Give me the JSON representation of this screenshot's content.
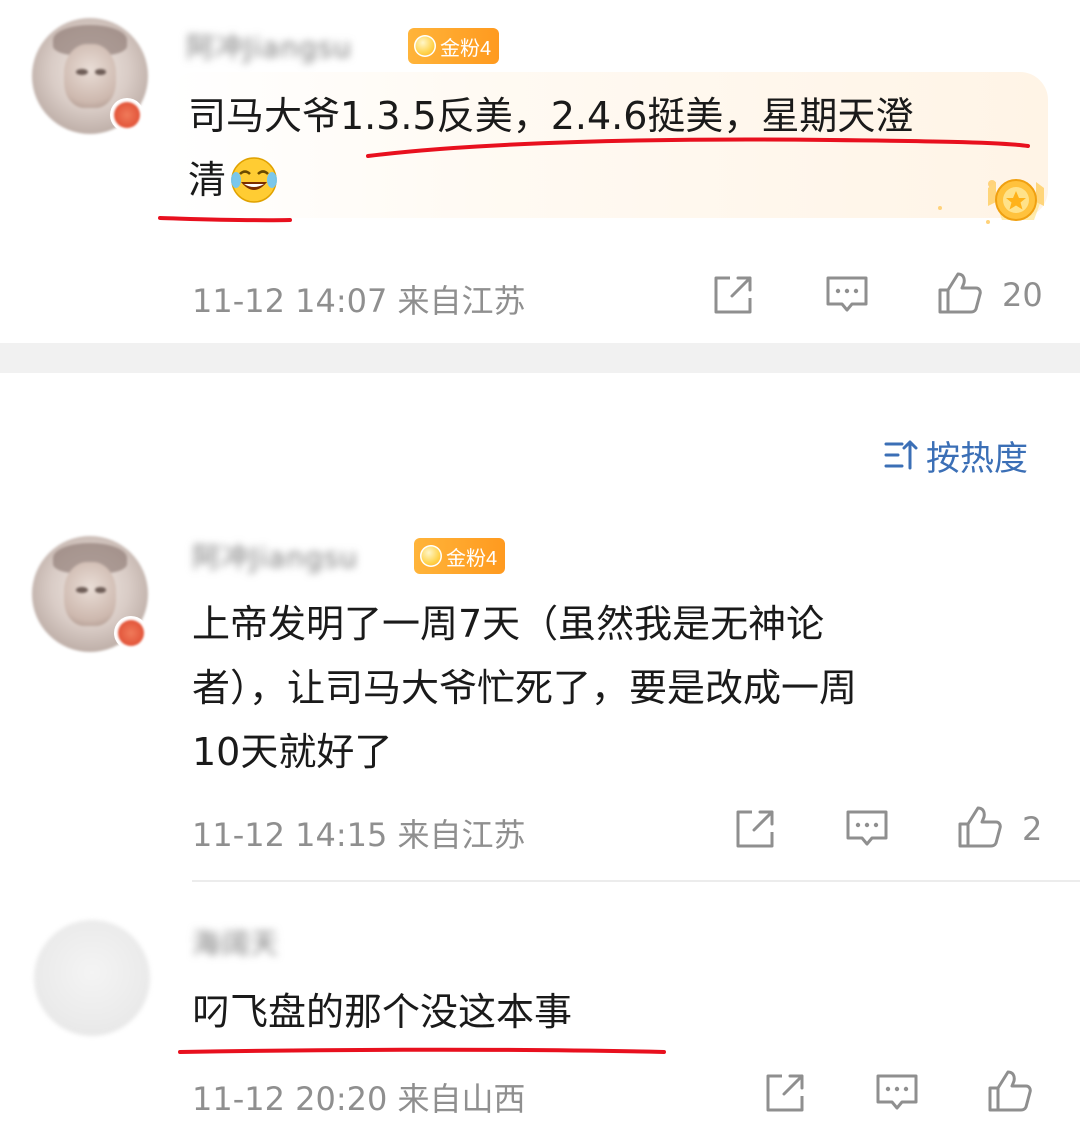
{
  "comments": [
    {
      "nickname": "阿冲Jiangsu",
      "fan_badge": "金粉4",
      "text_line1": "司马大爷1.3.5反美，2.4.6挺美，星期天澄",
      "text_line2": "清",
      "emoji": "laugh-cry",
      "timestamp": "11-12 14:07",
      "location": "来自江苏",
      "likes": "20"
    },
    {
      "nickname": "阿冲Jiangsu",
      "fan_badge": "金粉4",
      "text_line1": "上帝发明了一周7天（虽然我是无神论",
      "text_line2": "者），让司马大爷忙死了，要是改成一周",
      "text_line3": "10天就好了",
      "timestamp": "11-12 14:15",
      "location": "来自江苏",
      "likes": "2"
    },
    {
      "nickname": "海阔天",
      "text_line1": "叼飞盘的那个没这本事",
      "timestamp": "11-12 20:20",
      "location": "来自山西",
      "likes": ""
    }
  ],
  "sort": {
    "label": "按热度"
  },
  "colors": {
    "accent_blue": "#3b6fb6",
    "meta_gray": "#8f8f8f",
    "fan_gold": "#ff9a1f",
    "underline_red": "#e8101e"
  }
}
